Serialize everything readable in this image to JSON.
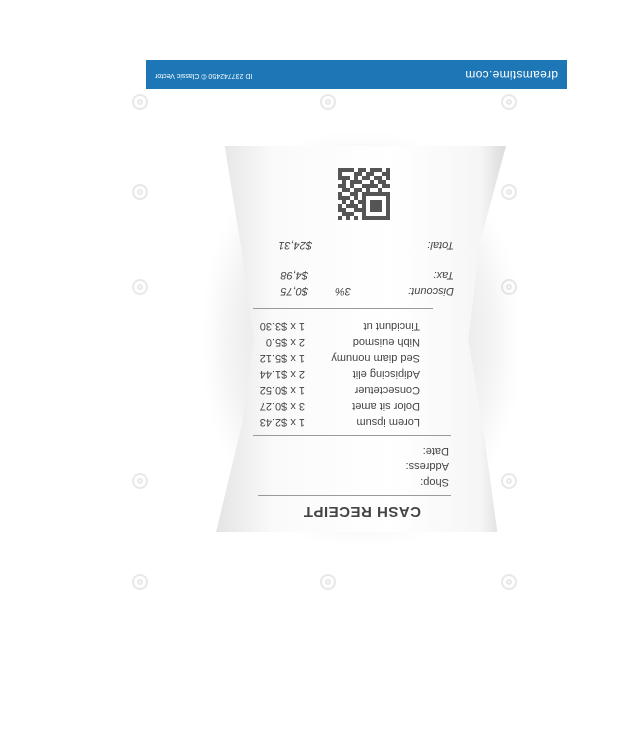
{
  "banner": {
    "brand": "dreamstime.com",
    "credit": "ID 237742450 © Classic Vector",
    "color": "#1d76b5"
  },
  "receipt": {
    "title": "CASH RECEIPT",
    "header_fields": [
      "Shop:",
      "Address:",
      "Date:"
    ],
    "items": [
      {
        "name": "Lorem ipsum",
        "qty_price": "1 x $2.43"
      },
      {
        "name": "Dolor sit amet",
        "qty_price": "3 x $0.27"
      },
      {
        "name": "Consectetuer",
        "qty_price": "1 x $0.52"
      },
      {
        "name": "Adipiscing elit",
        "qty_price": "2 x $1.44"
      },
      {
        "name": "Sed diam nonumy",
        "qty_price": "1 x $5.12"
      },
      {
        "name": "Nibh euismod",
        "qty_price": "2 x $5.0"
      },
      {
        "name": "Tincidunt ut",
        "qty_price": "1 x $3.30"
      }
    ],
    "discount": {
      "label": "Discount:",
      "percent": "3%",
      "value": "$0,75"
    },
    "tax": {
      "label": "Tax:",
      "value": "$4,98"
    },
    "total": {
      "label": "Total:",
      "value": "$24,31"
    }
  }
}
